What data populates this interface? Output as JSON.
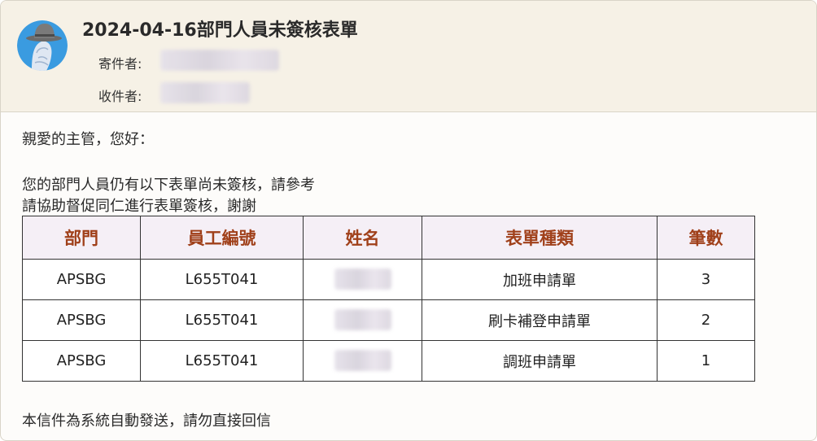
{
  "email": {
    "subject": "2024-04-16部門人員未簽核表單",
    "from_label": "寄件者:",
    "to_label": "收件者:"
  },
  "body": {
    "greeting": "親愛的主管，您好：",
    "line1": "您的部門人員仍有以下表單尚未簽核，請參考",
    "line2": "請協助督促同仁進行表單簽核，謝謝",
    "footer": "本信件為系統自動發送，請勿直接回信"
  },
  "table": {
    "headers": [
      "部門",
      "員工編號",
      "姓名",
      "表單種類",
      "筆數"
    ],
    "rows": [
      {
        "dept": "APSBG",
        "emp_id": "L655T041",
        "form_type": "加班申請單",
        "count": "3"
      },
      {
        "dept": "APSBG",
        "emp_id": "L655T041",
        "form_type": "刷卡補登申請單",
        "count": "2"
      },
      {
        "dept": "APSBG",
        "emp_id": "L655T041",
        "form_type": "調班申請單",
        "count": "1"
      }
    ]
  },
  "colors": {
    "header_bg": "#f6f1e6",
    "table_header_bg": "#f5eff6",
    "table_header_text": "#a0401a",
    "avatar_blue": "#3a9be0"
  }
}
